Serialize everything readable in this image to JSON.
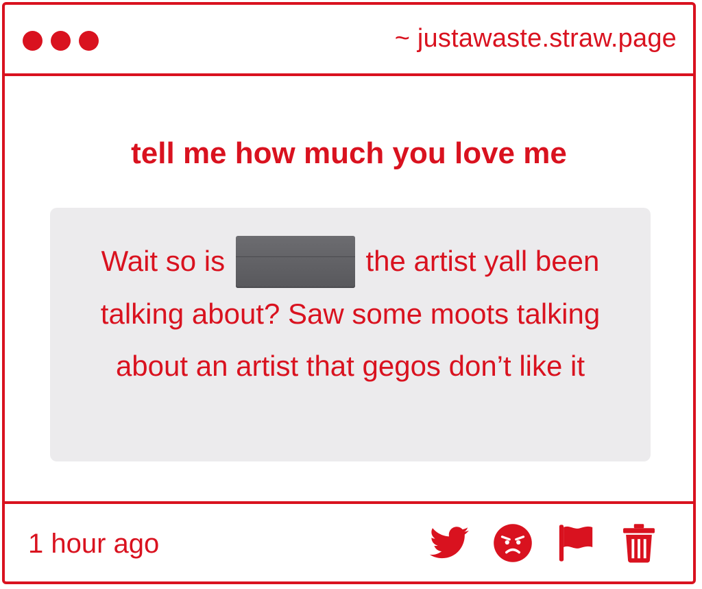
{
  "window": {
    "url": "~ justawaste.straw.page"
  },
  "question": {
    "text": "tell me how much you love me"
  },
  "answer": {
    "part1": "Wait so is",
    "redacted": "[redacted name]",
    "part2": "the artist yall been talking about? Saw some moots talking about an artist that gegos don’t like it"
  },
  "footer": {
    "timestamp": "1 hour ago",
    "actions": [
      "twitter-icon",
      "angry-face-icon",
      "flag-icon",
      "trash-icon"
    ]
  },
  "colors": {
    "accent": "#d9121f",
    "answer_background": "#ecebed",
    "redaction": "#616165"
  }
}
